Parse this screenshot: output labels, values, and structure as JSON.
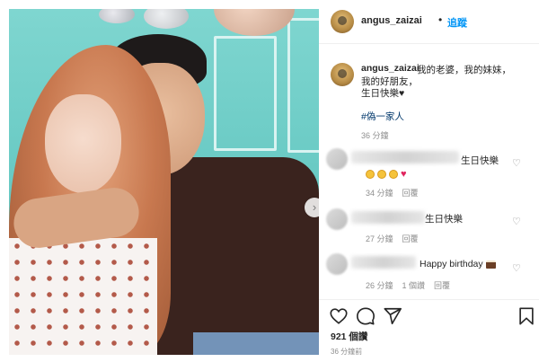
{
  "header": {
    "username": "angus_zaizai",
    "dot": "•",
    "follow_label": "追蹤"
  },
  "caption": {
    "username": "angus_zaizai",
    "line1": "我的老婆，我的妹妹，",
    "line2": "我的好朋友，",
    "line3": "生日快樂♥",
    "hashtag": "#偽一家人",
    "time": "36 分鐘"
  },
  "comments": [
    {
      "text": "生日快樂",
      "emoji": [
        "grinning-face",
        "grinning-face",
        "grinning-face",
        "red-heart"
      ],
      "time": "34 分鐘",
      "reply_label": "回覆"
    },
    {
      "text": "生日快樂",
      "time": "27 分鐘",
      "reply_label": "回覆"
    },
    {
      "text": "Happy birthday",
      "emoji": [
        "cake"
      ],
      "time": "26 分鐘",
      "likes": "1 個讚",
      "reply_label": "回覆"
    }
  ],
  "photo": {
    "carousel_next": "›"
  },
  "footer": {
    "likes": "921 個讚",
    "post_time": "36 分鐘前"
  },
  "icons": {
    "heart": "heart-icon",
    "comment": "comment-icon",
    "share": "share-icon",
    "save": "bookmark-icon"
  },
  "colors": {
    "follow": "#0095f6",
    "hashtag": "#00376b",
    "meta_gray": "#8e8e8e",
    "wall_teal": "#66c8c2",
    "tshirt": "#3a231e"
  }
}
